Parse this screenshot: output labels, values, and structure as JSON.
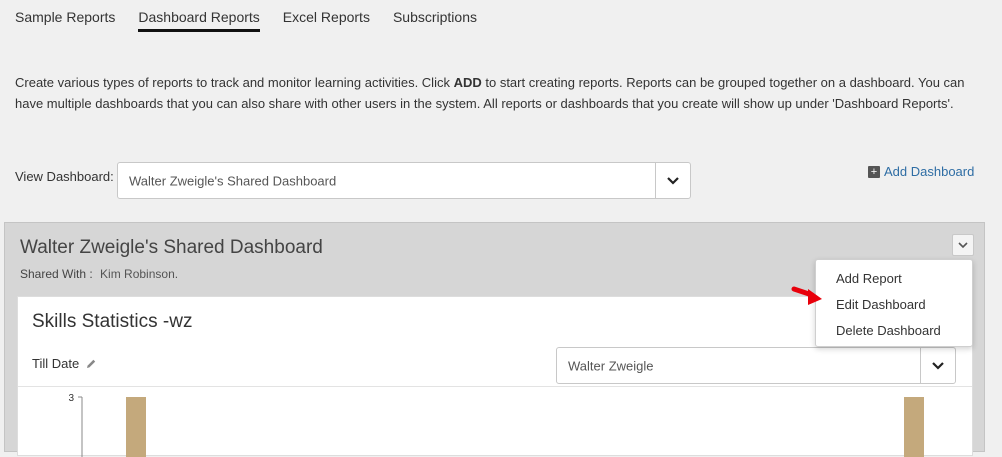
{
  "tabs": [
    {
      "label": "Sample Reports",
      "active": false
    },
    {
      "label": "Dashboard Reports",
      "active": true
    },
    {
      "label": "Excel Reports",
      "active": false
    },
    {
      "label": "Subscriptions",
      "active": false
    }
  ],
  "intro": {
    "part1": "Create various types of reports to track and monitor learning activities. Click ",
    "bold": "ADD",
    "part2": " to start creating reports. Reports can be grouped together on a dashboard. You can have multiple dashboards that you can also share with other users in the system. All reports or dashboards that you create will show up under 'Dashboard Reports'."
  },
  "view_dashboard": {
    "label": "View Dashboard:",
    "selected": "Walter Zweigle's Shared Dashboard"
  },
  "add_dashboard_label": "Add Dashboard",
  "dashboard": {
    "title": "Walter Zweigle's Shared Dashboard",
    "shared_with_label": "Shared With :",
    "shared_with_names": "Kim Robinson."
  },
  "menu": {
    "items": [
      "Add Report",
      "Edit Dashboard",
      "Delete Dashboard"
    ]
  },
  "report": {
    "title": "Skills Statistics -wz",
    "period": "Till Date",
    "user_selected": "Walter Zweigle"
  },
  "chart_data": {
    "type": "bar",
    "y_tick_label": "3",
    "bar_color": "#c4a97c",
    "values": [
      3,
      3
    ],
    "ylim": [
      0,
      3
    ]
  },
  "colors": {
    "link": "#2e6da4",
    "annotation_arrow": "#e8000b"
  }
}
